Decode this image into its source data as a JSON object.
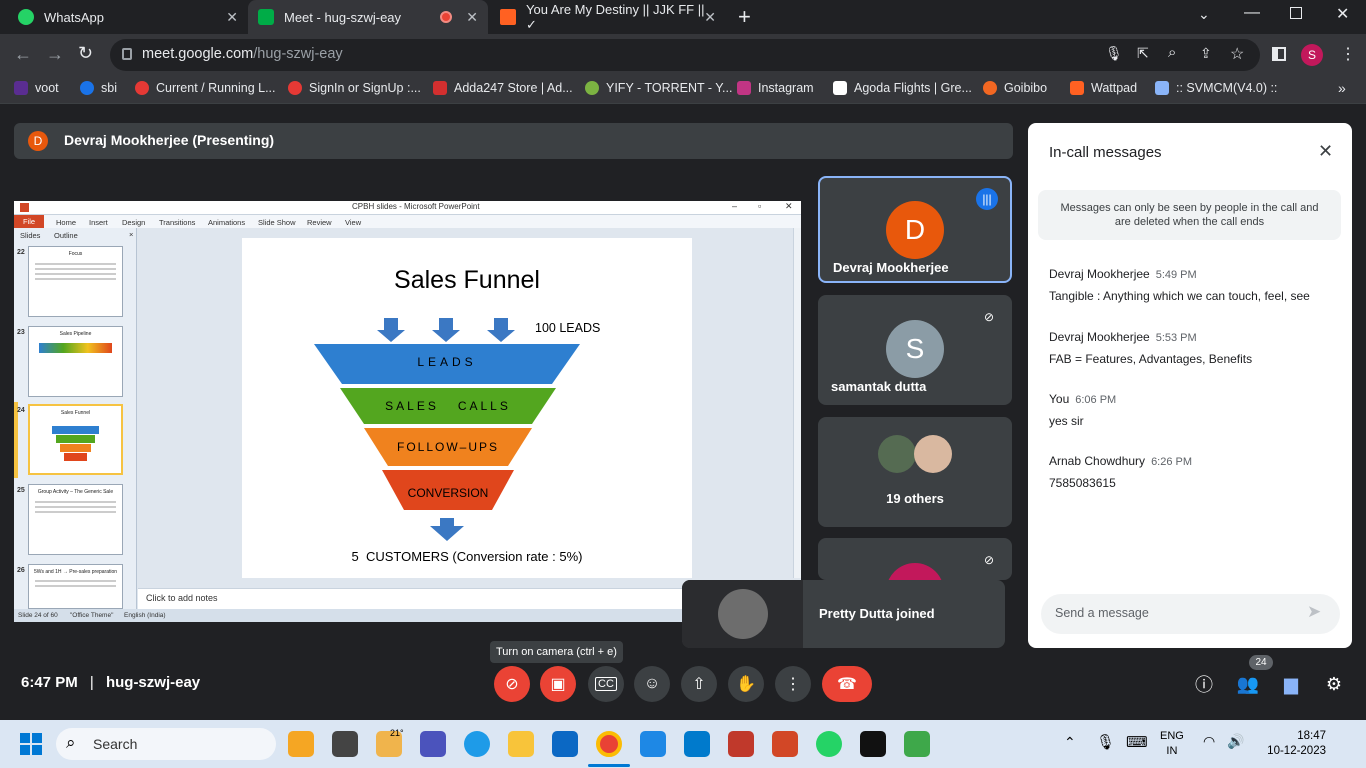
{
  "browser": {
    "tabs": [
      {
        "label": "WhatsApp",
        "color": "#25d366"
      },
      {
        "label": "Meet - hug-szwj-eay",
        "color": "#00ac47"
      },
      {
        "label": "You Are My Destiny || JJK FF || ✓",
        "color": "#ff6122"
      }
    ],
    "new_tab": "+",
    "url_host": "meet.google.com",
    "url_path": "/hug-szwj-eay",
    "profile": "S",
    "bookmarks": [
      {
        "label": "voot",
        "color": "#5a2d91"
      },
      {
        "label": "sbi",
        "color": "#1a73e8"
      },
      {
        "label": "Current / Running L...",
        "color": "#e53935"
      },
      {
        "label": "SignIn or SignUp :...",
        "color": "#e53935"
      },
      {
        "label": "Adda247 Store | Ad...",
        "color": "#d32f2f"
      },
      {
        "label": "YIFY - TORRENT - Y...",
        "color": "#7cb342"
      },
      {
        "label": "Instagram",
        "color": "#c13584"
      },
      {
        "label": "Agoda Flights | Gre...",
        "color": "#ffffff"
      },
      {
        "label": "Goibibo",
        "color": "#f26722"
      },
      {
        "label": "Wattpad",
        "color": "#ff6122"
      },
      {
        "label": ":: SVMCM(V4.0) ::",
        "color": "#8ab4f8"
      }
    ]
  },
  "meet": {
    "presenter_initial": "D",
    "presenting_label": "Devraj Mookherjee (Presenting)",
    "participants": [
      {
        "initial": "D",
        "name": "Devraj Mookherjee",
        "color": "#e8580c"
      },
      {
        "initial": "S",
        "name": "samantak dutta",
        "color": "#8b9ca6"
      },
      {
        "initial": "",
        "name": "19 others",
        "color": "#5f6368"
      },
      {
        "initial": "",
        "name": "",
        "color": "#c2185b"
      }
    ],
    "toast": "Pretty Dutta joined",
    "tooltip": "Turn on camera (ctrl + e)",
    "time": "6:47 PM",
    "separator": "|",
    "meeting_code": "hug-szwj-eay",
    "participant_count": "24"
  },
  "panel": {
    "title": "In-call messages",
    "notice": "Messages can only be seen by people in the call and are deleted when the call ends",
    "messages": [
      {
        "sender": "Devraj Mookherjee",
        "time": "5:49 PM",
        "text": "Tangible : Anything which we can touch, feel, see"
      },
      {
        "sender": "Devraj Mookherjee",
        "time": "5:53 PM",
        "text": "FAB = Features, Advantages, Benefits"
      },
      {
        "sender": "You",
        "time": "6:06 PM",
        "text": "yes sir"
      },
      {
        "sender": "Arnab Chowdhury",
        "time": "6:26 PM",
        "text": "7585083615"
      }
    ],
    "input_placeholder": "Send a message"
  },
  "ppt": {
    "window_title": "CPBH slides - Microsoft PowerPoint",
    "ribbon_tabs": [
      "File",
      "Home",
      "Insert",
      "Design",
      "Transitions",
      "Animations",
      "Slide Show",
      "Review",
      "View"
    ],
    "pane_tabs": [
      "Slides",
      "Outline"
    ],
    "thumbnails": [
      {
        "num": "22",
        "title": "Focus"
      },
      {
        "num": "23",
        "title": "Sales Pipeline"
      },
      {
        "num": "24",
        "title": "Sales Funnel"
      },
      {
        "num": "25",
        "title": "Group Activity – The Generic Sale"
      },
      {
        "num": "26",
        "title": "5Ws and 1H → Pre-sales preparation"
      }
    ],
    "notes": "Click to add notes",
    "status": {
      "slide": "Slide 24 of 60",
      "theme": "\"Office Theme\"",
      "lang": "English (India)"
    },
    "slide": {
      "title": "Sales Funnel",
      "leads": "100 LEADS",
      "stages": [
        {
          "label": "LEADS",
          "color": "#2e7fd0"
        },
        {
          "label": "SALES   CALLS",
          "color": "#53a61f"
        },
        {
          "label": "FOLLOW–UPS",
          "color": "#f0821e"
        },
        {
          "label": "CONVERSION",
          "color": "#e0461c"
        }
      ],
      "result": "5  CUSTOMERS (Conversion rate : 5%)"
    }
  },
  "taskbar": {
    "search": "Search",
    "weather": "21°",
    "lang": "ENG",
    "region": "IN",
    "time": "18:47",
    "date": "10-12-2023"
  }
}
